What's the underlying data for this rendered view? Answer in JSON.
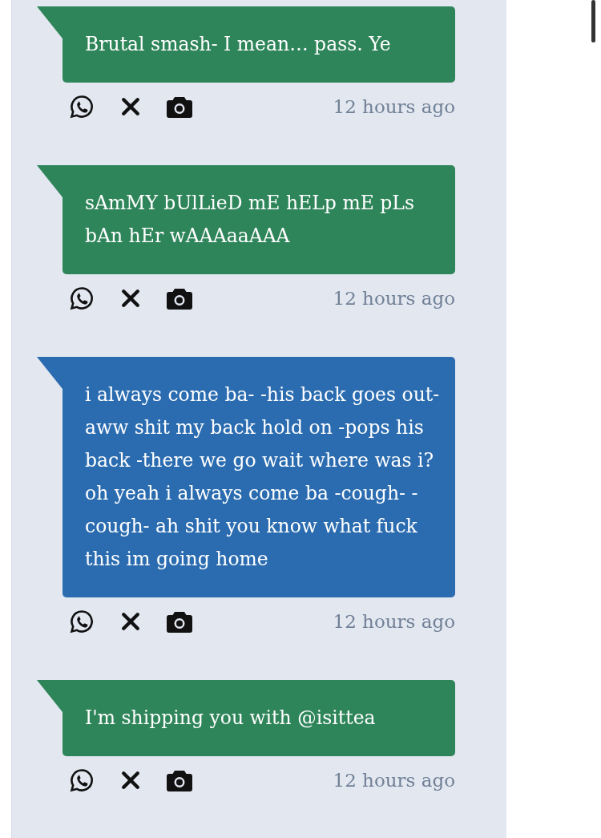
{
  "messages": [
    {
      "text": "Brutal smash- I mean… pass. Ye",
      "color": "#2f855a",
      "time": "12 hours ago"
    },
    {
      "text": "sAmMY bUlLieD mE hELp mE pLs bAn hEr wAAAaaAAA",
      "color": "#2f855a",
      "time": "12 hours ago"
    },
    {
      "text": "i always come ba- -his back goes out- aww shit my back hold on -pops his back -there we go wait where was i? oh yeah i always come ba -cough- -cough- ah shit you know what fuck this im going home",
      "color": "#2b6cb0",
      "time": "12 hours ago"
    },
    {
      "text": "I'm shipping you with @isittea",
      "color": "#2f855a",
      "time": "12 hours ago"
    }
  ]
}
